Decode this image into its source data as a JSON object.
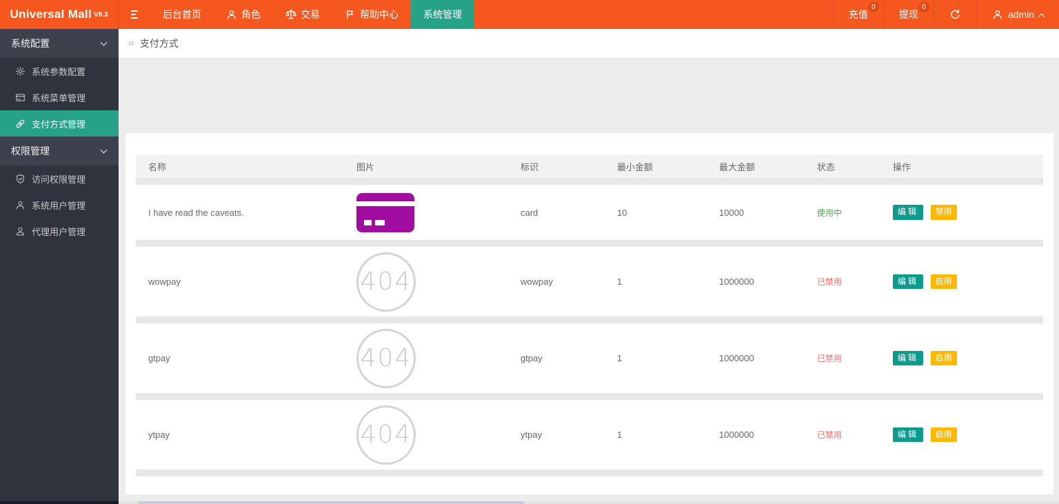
{
  "colors": {
    "orange": "#F6571E",
    "teal": "#26A287",
    "btnTeal": "#0E9A8C",
    "btnYellow": "#FFB800",
    "green": "#4CAF50",
    "red": "#F56C6C",
    "purple": "#A10DA1"
  },
  "topbar": {
    "brand": "Universal Mall",
    "version": "V8.3",
    "nav": [
      {
        "label": "后台首页"
      },
      {
        "label": "角色"
      },
      {
        "label": "交易"
      },
      {
        "label": "帮助中心"
      },
      {
        "label": "系统管理"
      }
    ],
    "recharge_label": "充值",
    "recharge_badge": "0",
    "withdraw_label": "提现",
    "withdraw_badge": "0",
    "user": "admin"
  },
  "sidebar": {
    "sections": [
      {
        "label": "系统配置",
        "items": [
          {
            "label": "系统参数配置"
          },
          {
            "label": "系统菜单管理"
          },
          {
            "label": "支付方式管理"
          }
        ]
      },
      {
        "label": "权限管理",
        "items": [
          {
            "label": "访问权限管理"
          },
          {
            "label": "系统用户管理"
          },
          {
            "label": "代理用户管理"
          }
        ]
      }
    ]
  },
  "breadcrumb": {
    "caret": "»",
    "current": "支付方式"
  },
  "table": {
    "headers": [
      "名称",
      "图片",
      "标识",
      "最小金额",
      "最大金额",
      "状态",
      "操作"
    ],
    "image_404": "404",
    "rows": [
      {
        "name": "I have read the caveats.",
        "image": "card-icon",
        "ident": "card",
        "min": "10",
        "max": "10000",
        "status": "使用中",
        "status_type": "active",
        "actions": [
          "编辑",
          "禁用"
        ]
      },
      {
        "name": "wowpay",
        "image": "404",
        "ident": "wowpay",
        "min": "1",
        "max": "1000000",
        "status": "已禁用",
        "status_type": "disabled",
        "actions": [
          "编辑",
          "启用"
        ]
      },
      {
        "name": "gtpay",
        "image": "404",
        "ident": "gtpay",
        "min": "1",
        "max": "1000000",
        "status": "已禁用",
        "status_type": "disabled",
        "actions": [
          "编辑",
          "启用"
        ]
      },
      {
        "name": "ytpay",
        "image": "404",
        "ident": "ytpay",
        "min": "1",
        "max": "1000000",
        "status": "已禁用",
        "status_type": "disabled",
        "actions": [
          "编辑",
          "启用"
        ]
      }
    ]
  }
}
